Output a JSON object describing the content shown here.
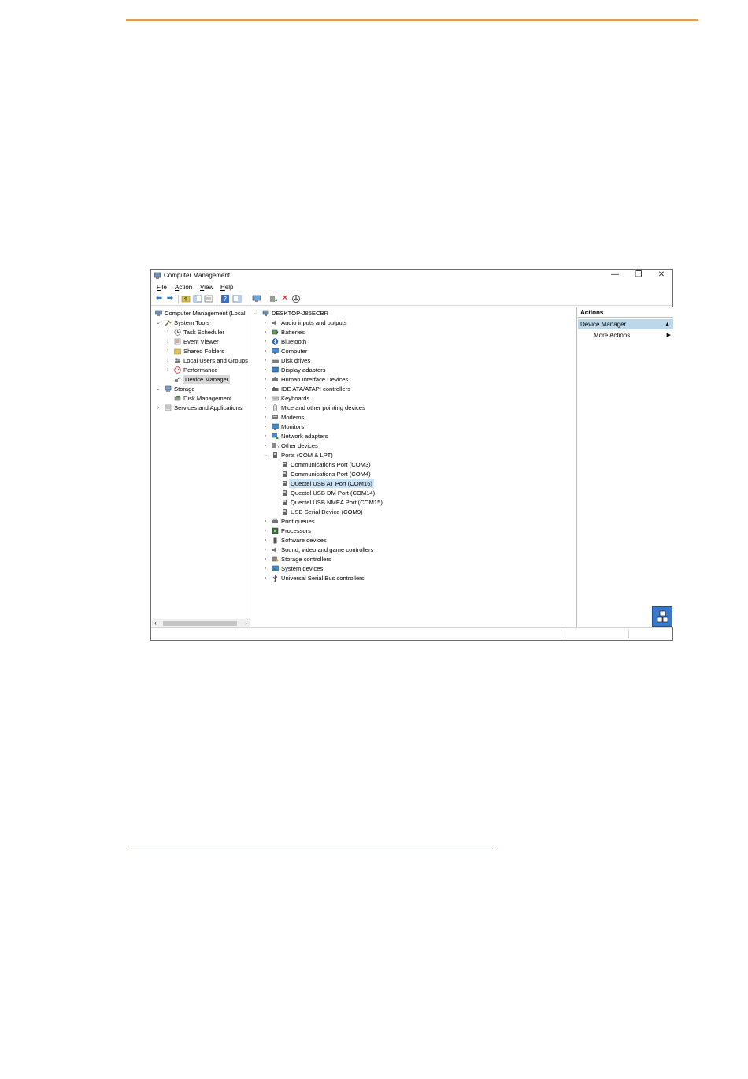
{
  "window": {
    "title": "Computer Management",
    "controls": {
      "minimize": "—",
      "restore": "❐",
      "close": "✕"
    }
  },
  "menu": [
    {
      "label": "File",
      "key": "F",
      "rest": "ile"
    },
    {
      "label": "Action",
      "key": "A",
      "rest": "ction"
    },
    {
      "label": "View",
      "key": "V",
      "rest": "iew"
    },
    {
      "label": "Help",
      "key": "H",
      "rest": "elp"
    }
  ],
  "left_tree": {
    "root": "Computer Management (Local",
    "system_tools": "System Tools",
    "task_scheduler": "Task Scheduler",
    "event_viewer": "Event Viewer",
    "shared_folders": "Shared Folders",
    "local_users": "Local Users and Groups",
    "performance": "Performance",
    "device_manager": "Device Manager",
    "storage": "Storage",
    "disk_management": "Disk Management",
    "services": "Services and Applications"
  },
  "device_tree": {
    "computer": "DESKTOP-J85ECBR",
    "categories": {
      "audio": "Audio inputs and outputs",
      "batteries": "Batteries",
      "bluetooth": "Bluetooth",
      "computer": "Computer",
      "disk": "Disk drives",
      "display": "Display adapters",
      "hid": "Human Interface Devices",
      "ide": "IDE ATA/ATAPI controllers",
      "keyboards": "Keyboards",
      "mice": "Mice and other pointing devices",
      "modems": "Modems",
      "monitors": "Monitors",
      "network": "Network adapters",
      "other": "Other devices",
      "ports": "Ports (COM & LPT)",
      "print": "Print queues",
      "processors": "Processors",
      "software": "Software devices",
      "sound": "Sound, video and game controllers",
      "storage_ctrl": "Storage controllers",
      "system": "System devices",
      "usb": "Universal Serial Bus controllers"
    },
    "ports": {
      "com3": "Communications Port (COM3)",
      "com4": "Communications Port (COM4)",
      "com16": "Quectel USB AT Port (COM16)",
      "com14": "Quectel USB DM Port (COM14)",
      "com15": "Quectel USB NMEA Port (COM15)",
      "com9": "USB Serial Device (COM9)"
    }
  },
  "actions": {
    "header": "Actions",
    "section": "Device Manager",
    "more": "More Actions"
  },
  "colors": {
    "accent_rule": "#e0a060",
    "selection": "#cce4f7",
    "actions_section": "#bcd6ea"
  }
}
